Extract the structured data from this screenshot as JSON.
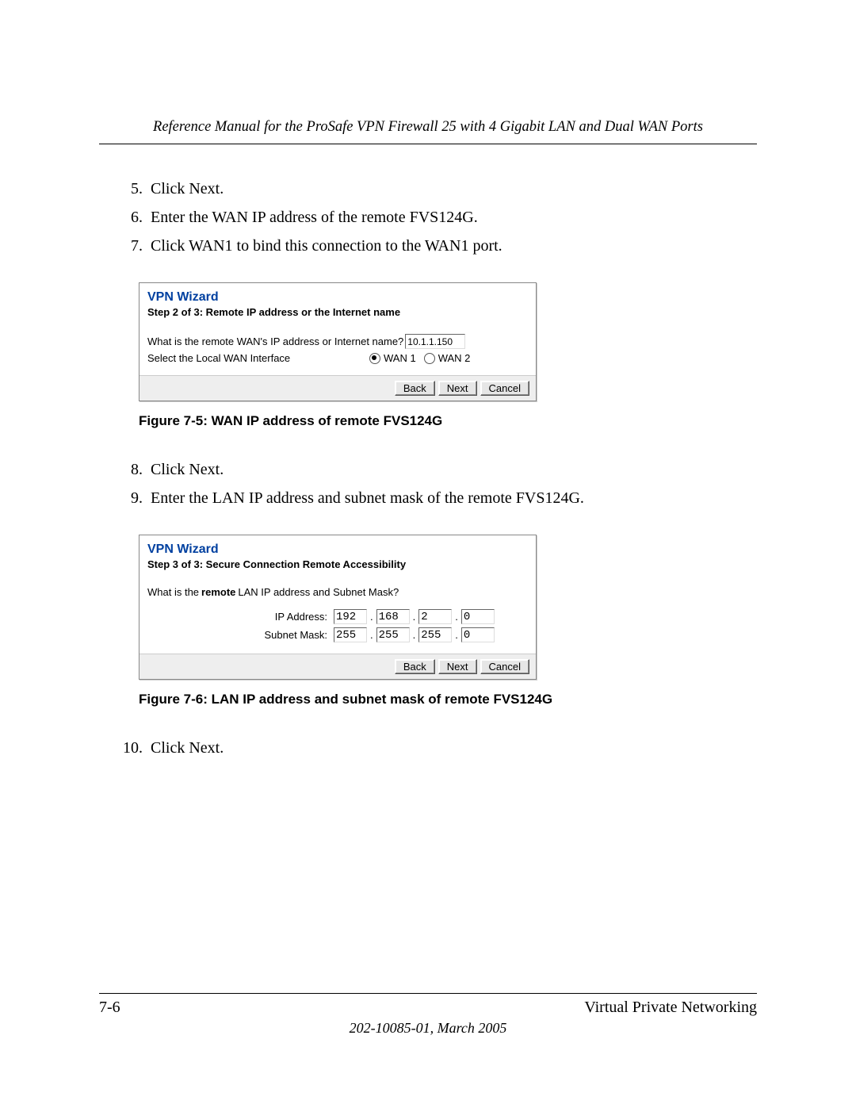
{
  "header": {
    "title": "Reference Manual for the ProSafe VPN Firewall 25 with 4 Gigabit LAN and Dual WAN Ports"
  },
  "steps_a": [
    "Click Next.",
    "Enter the WAN IP address of the remote FVS124G.",
    "Click WAN1 to bind this connection to the WAN1 port."
  ],
  "wiz1": {
    "title": "VPN Wizard",
    "subtitle": "Step 2 of 3: Remote IP address or the Internet name",
    "q1": "What is the remote WAN's IP address or Internet name?",
    "ip": "10.1.1.150",
    "q2": "Select the Local WAN Interface",
    "opt1": "WAN 1",
    "opt2": "WAN 2",
    "back": "Back",
    "next": "Next",
    "cancel": "Cancel"
  },
  "caption1": "Figure 7-5:  WAN IP address of remote FVS124G",
  "steps_b": [
    "Click Next.",
    "Enter the LAN IP address and subnet mask of the remote FVS124G."
  ],
  "wiz2": {
    "title": "VPN Wizard",
    "subtitle": "Step 3 of 3: Secure Connection Remote Accessibility",
    "q_pre": "What is the ",
    "q_bold": "remote",
    "q_post": " LAN IP address and Subnet Mask?",
    "ip_label": "IP Address:",
    "ip": {
      "a": "192",
      "b": "168",
      "c": "2",
      "d": "0"
    },
    "mask_label": "Subnet Mask:",
    "mask": {
      "a": "255",
      "b": "255",
      "c": "255",
      "d": "0"
    },
    "back": "Back",
    "next": "Next",
    "cancel": "Cancel"
  },
  "caption2": "Figure 7-6:  LAN IP address and subnet mask of remote FVS124G",
  "steps_c": [
    "Click Next."
  ],
  "footer": {
    "page": "7-6",
    "section": "Virtual Private Networking",
    "doc": "202-10085-01, March 2005"
  }
}
